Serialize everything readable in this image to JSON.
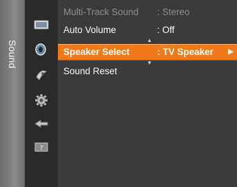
{
  "sidebar": {
    "title": "Sound",
    "icons": [
      "picture-icon",
      "sound-icon",
      "channel-icon",
      "setup-icon",
      "input-icon",
      "support-icon"
    ]
  },
  "menu": {
    "items": [
      {
        "label": "Multi-Track Sound",
        "value": ": Stereo",
        "state": "disabled"
      },
      {
        "label": "Auto Volume",
        "value": ": Off",
        "state": "normal"
      },
      {
        "label": "Speaker Select",
        "value": ": TV Speaker",
        "state": "selected"
      },
      {
        "label": "Sound Reset",
        "value": "",
        "state": "normal"
      }
    ]
  },
  "colors": {
    "highlight": "#f07a1a",
    "menu_bg": "#3b3b3b",
    "iconbar_bg": "#2a2a2a",
    "sidetab_bg": "#7d7d7d"
  }
}
